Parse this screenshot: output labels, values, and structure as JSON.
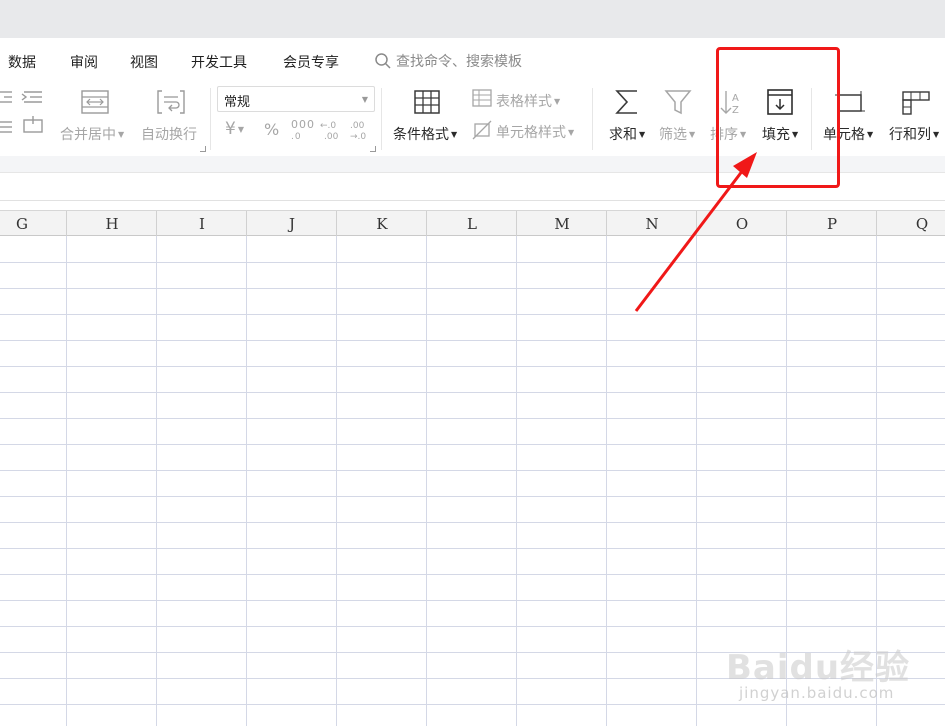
{
  "menu": {
    "items": [
      "数据",
      "审阅",
      "视图",
      "开发工具",
      "会员专享"
    ],
    "search_placeholder": "查找命令、搜索模板"
  },
  "ribbon": {
    "merge_center": "合并居中",
    "auto_wrap": "自动换行",
    "number_format": "常规",
    "currency_symbol": "¥",
    "percent_symbol": "%",
    "thousands_symbol": "000",
    "cond_format": "条件格式",
    "table_style": "表格样式",
    "cell_style": "单元格样式",
    "sum": "求和",
    "filter": "筛选",
    "sort": "排序",
    "fill": "填充",
    "cell": "单元格",
    "row_col": "行和列"
  },
  "columns": [
    "G",
    "H",
    "I",
    "J",
    "K",
    "L",
    "M",
    "N",
    "O",
    "P",
    "Q"
  ],
  "watermark": {
    "logo": "Baidu经验",
    "url": "jingyan.baidu.com"
  },
  "colors": {
    "highlight": "#f01818",
    "grid_line": "#d4d8e6"
  }
}
